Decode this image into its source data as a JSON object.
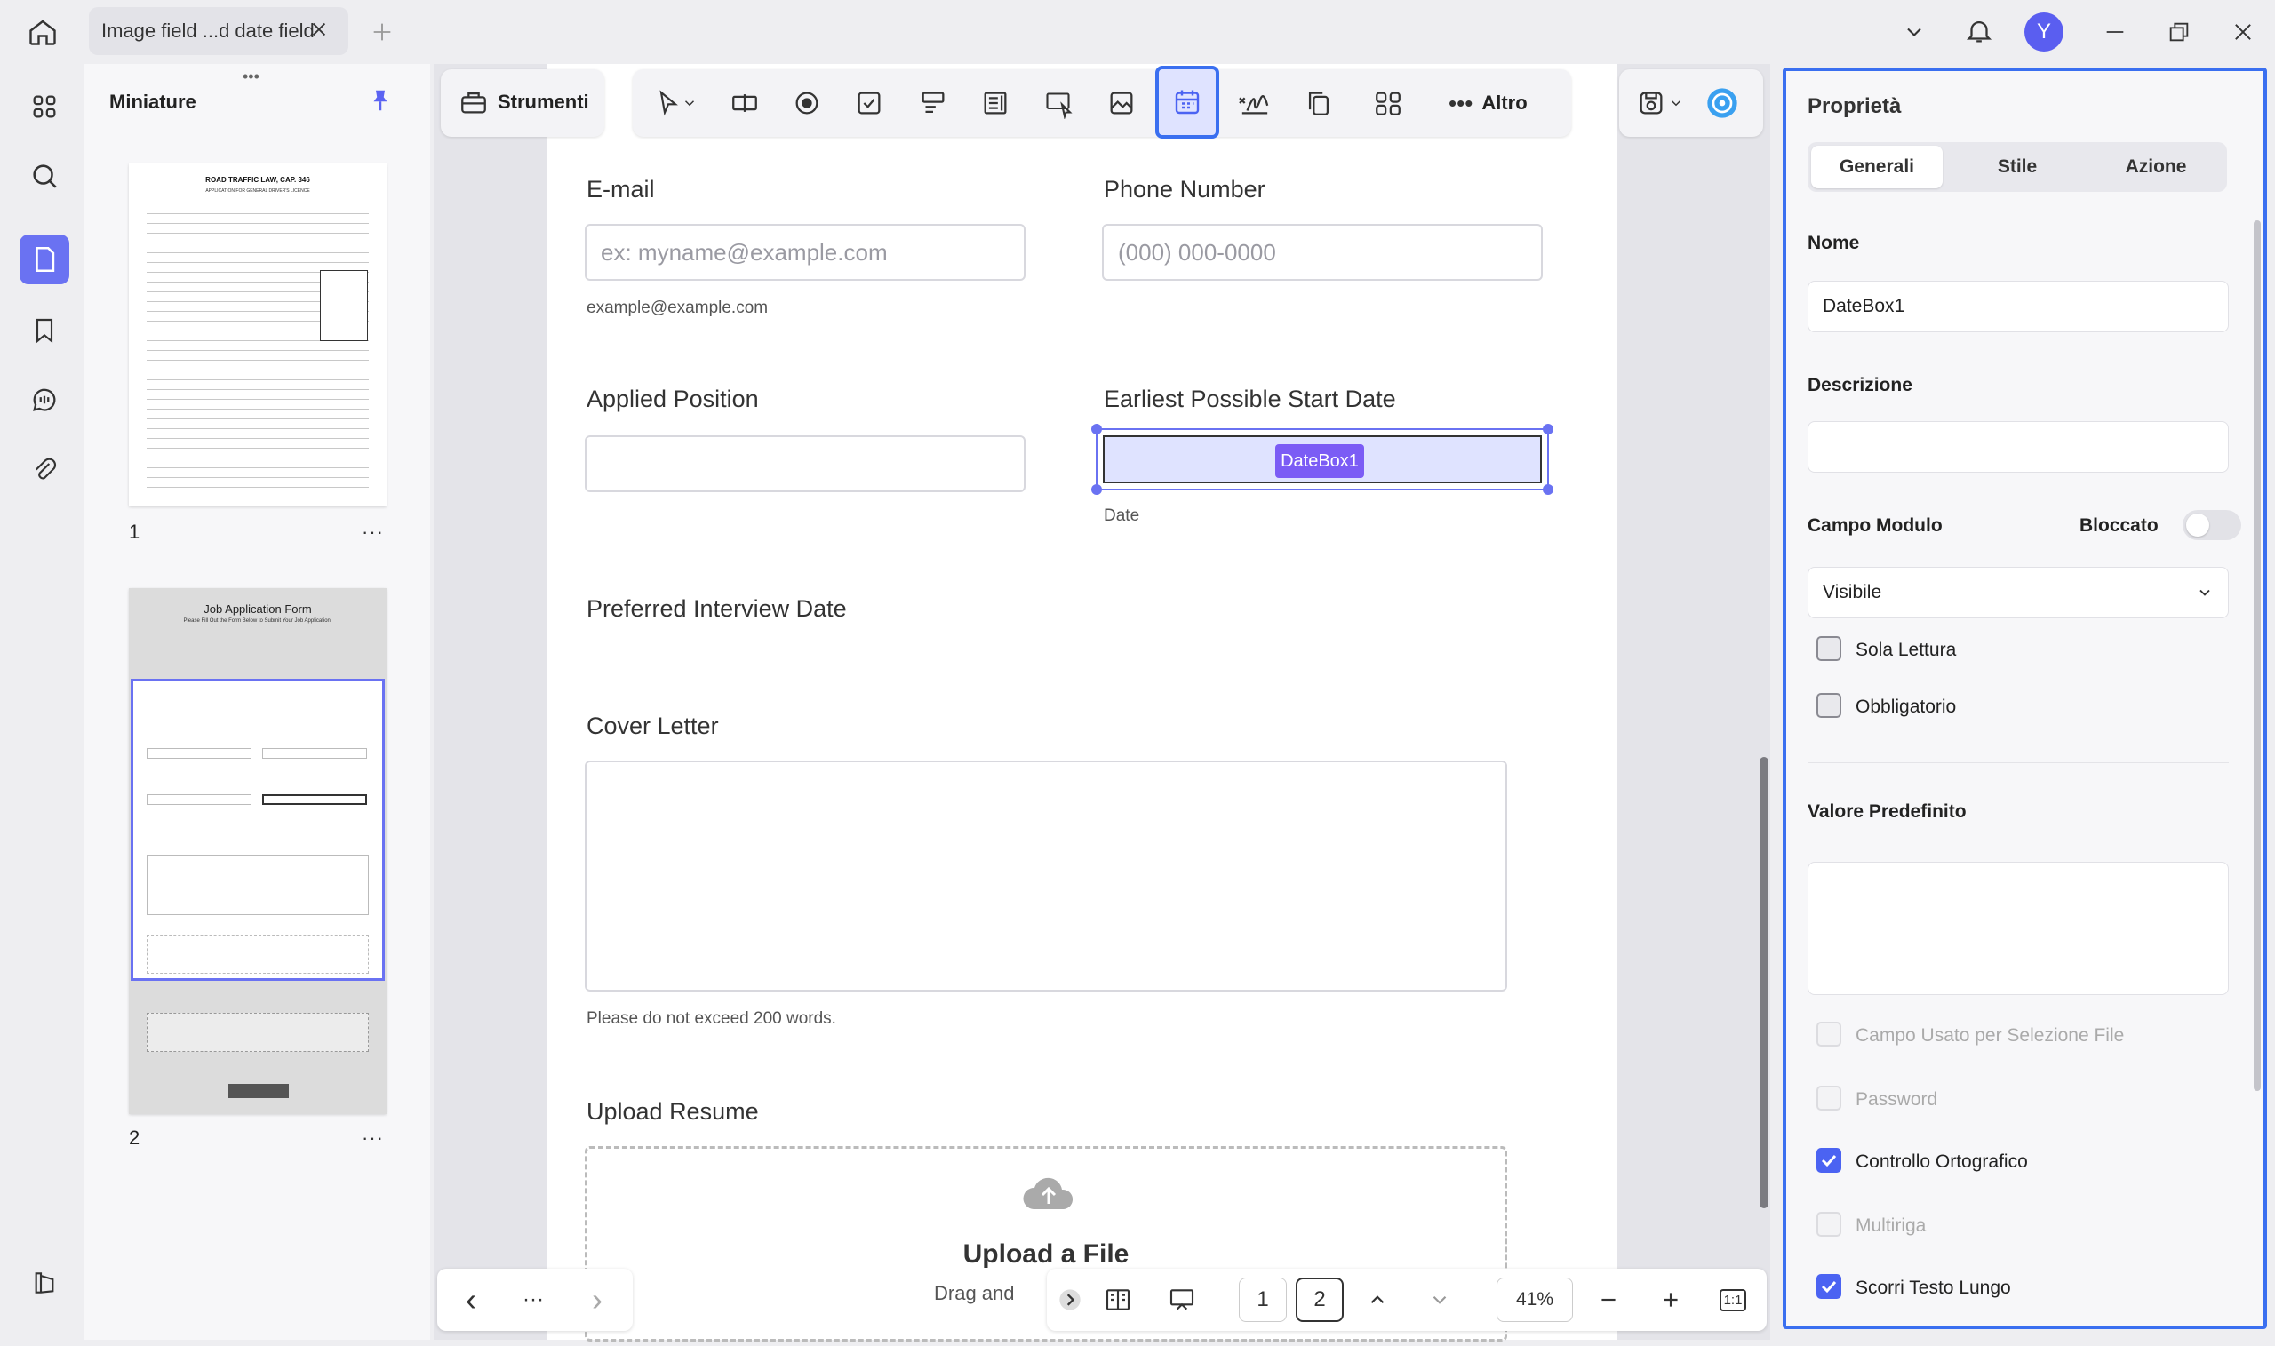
{
  "window": {
    "tab_title": "Image field ...d date field",
    "avatar_letter": "Y"
  },
  "sidebar": {
    "icons": [
      "home-icon",
      "grid-icon",
      "search-icon",
      "pages-icon",
      "bookmark-icon",
      "comment-icon",
      "attachment-icon",
      "panel-icon"
    ]
  },
  "thumbnails": {
    "title": "Miniature",
    "pages": [
      {
        "number": "1",
        "heading": "ROAD TRAFFIC LAW, CAP. 346",
        "subheading": "APPLICATION FOR GENERAL DRIVER'S LICENCE"
      },
      {
        "number": "2",
        "heading": "Job Application Form",
        "subheading": "Please Fill Out the Form Below to Submit Your Job Application!"
      }
    ],
    "more_label": "···"
  },
  "toolbar": {
    "tools_label": "Strumenti",
    "more_label": "Altro"
  },
  "form": {
    "email_label": "E-mail",
    "email_placeholder": "ex: myname@example.com",
    "email_hint": "example@example.com",
    "phone_label": "Phone Number",
    "phone_placeholder": "(000) 000-0000",
    "position_label": "Applied Position",
    "start_label": "Earliest Possible Start Date",
    "datebox_name": "DateBox1",
    "date_hint": "Date",
    "interview_label": "Preferred Interview Date",
    "cover_label": "Cover Letter",
    "cover_hint": "Please do not exceed 200 words.",
    "upload_label": "Upload Resume",
    "upload_title": "Upload a File",
    "upload_sub": "Drag and"
  },
  "bottom_nav": {
    "prev": "‹",
    "dots": "···",
    "next": "›",
    "page1": "1",
    "page2": "2",
    "zoom": "41%",
    "fit": "1:1"
  },
  "properties": {
    "title": "Proprietà",
    "tabs": [
      "Generali",
      "Stile",
      "Azione"
    ],
    "active_tab": "Generali",
    "name_label": "Nome",
    "name_value": "DateBox1",
    "desc_label": "Descrizione",
    "desc_value": "",
    "form_field_label": "Campo Modulo",
    "locked_label": "Bloccato",
    "locked": false,
    "visibility": "Visibile",
    "readonly_label": "Sola Lettura",
    "required_label": "Obbligatorio",
    "default_label": "Valore Predefinito",
    "default_value": "",
    "file_select_label": "Campo Usato per Selezione File",
    "password_label": "Password",
    "spell_label": "Controllo Ortografico",
    "multiline_label": "Multiriga",
    "scroll_label": "Scorri Testo Lungo",
    "checks": {
      "readonly": false,
      "required": false,
      "file_select": false,
      "password": false,
      "spell": true,
      "multiline": false,
      "scroll": true
    }
  },
  "colors": {
    "accent": "#4b63f2",
    "panel_border": "#3a6ff0",
    "selection": "#6a72f2"
  }
}
